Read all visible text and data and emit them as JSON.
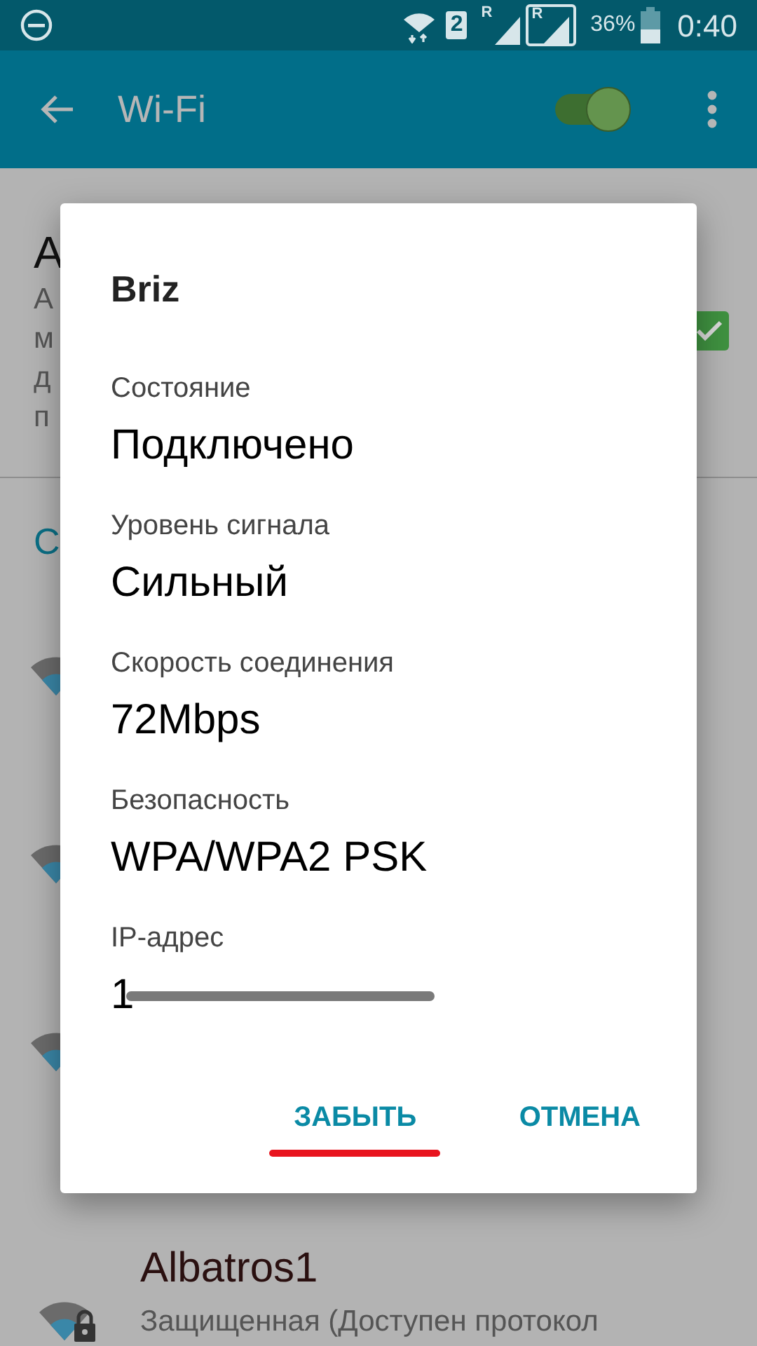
{
  "status_bar": {
    "sim_badge": "2",
    "roaming": [
      "R",
      "R"
    ],
    "battery": "36%",
    "time": "0:40"
  },
  "app_bar": {
    "title": "Wi-Fi",
    "wifi_on": true
  },
  "background": {
    "title": "А",
    "description_lines": [
      "А",
      "м",
      "д",
      "п"
    ],
    "checkbox_checked": true,
    "section": "С",
    "network": {
      "name": "Albatros1",
      "detail": "Защищенная (Доступен протокол",
      "secured": true
    }
  },
  "dialog": {
    "title": "Briz",
    "fields": [
      {
        "label": "Состояние",
        "value": "Подключено",
        "redacted": false
      },
      {
        "label": "Уровень сигнала",
        "value": "Сильный",
        "redacted": false
      },
      {
        "label": "Скорость соединения",
        "value": "72Mbps",
        "redacted": false
      },
      {
        "label": "Безопасность",
        "value": "WPA/WPA2 PSK",
        "redacted": false
      },
      {
        "label": "IP-адрес",
        "value": "1",
        "redacted": true
      }
    ],
    "buttons": [
      {
        "label": "ЗАБЫТЬ",
        "underlined": true
      },
      {
        "label": "ОТМЕНА",
        "underlined": false
      }
    ]
  }
}
